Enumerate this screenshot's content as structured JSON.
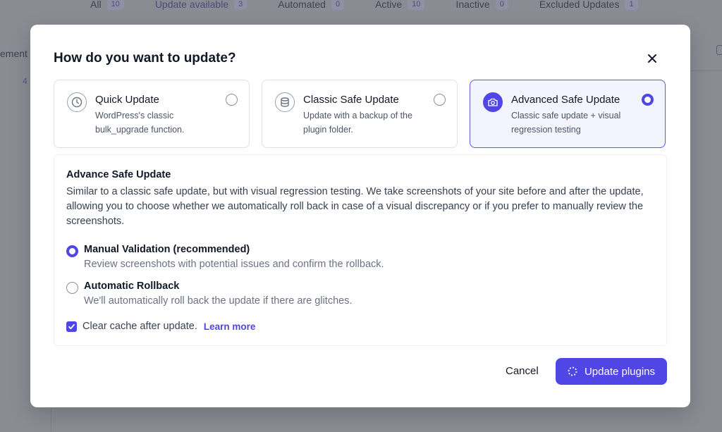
{
  "background": {
    "tabs": [
      {
        "label": "All",
        "count": "10"
      },
      {
        "label": "Update available",
        "count": "3"
      },
      {
        "label": "Automated",
        "count": "0"
      },
      {
        "label": "Active",
        "count": "10"
      },
      {
        "label": "Inactive",
        "count": "0"
      },
      {
        "label": "Excluded Updates",
        "count": "1"
      }
    ],
    "left_label": "ement",
    "left_number": "4"
  },
  "modal": {
    "title": "How do you want to update?",
    "close_icon": "close-icon",
    "options": [
      {
        "title": "Quick Update",
        "description": "WordPress's classic bulk_upgrade function.",
        "icon": "clock-icon",
        "selected": false
      },
      {
        "title": "Classic Safe Update",
        "description": "Update with a backup of the plugin folder.",
        "icon": "database-icon",
        "selected": false
      },
      {
        "title": "Advanced Safe Update",
        "description": "Classic safe update + visual regression testing",
        "icon": "camera-check-icon",
        "selected": true
      }
    ],
    "detail": {
      "title": "Advance Safe Update",
      "description": "Similar to a classic safe update, but with visual regression testing. We take screenshots of your site before and after the update, allowing you to choose whether we automatically roll back in case of a visual discrepancy or if you prefer to manually review the screenshots.",
      "choices": [
        {
          "title": "Manual Validation (recommended)",
          "description": "Review screenshots with potential issues and confirm the rollback.",
          "selected": true
        },
        {
          "title": "Automatic Rollback",
          "description": "We'll automatically roll back the update if there are glitches.",
          "selected": false
        }
      ],
      "clear_cache_label": "Clear cache after update.",
      "clear_cache_checked": true,
      "learn_more": "Learn more"
    },
    "cancel_label": "Cancel",
    "update_label": "Update plugins"
  },
  "colors": {
    "accent": "#4f46e5",
    "overlay": "#8a8c93"
  }
}
